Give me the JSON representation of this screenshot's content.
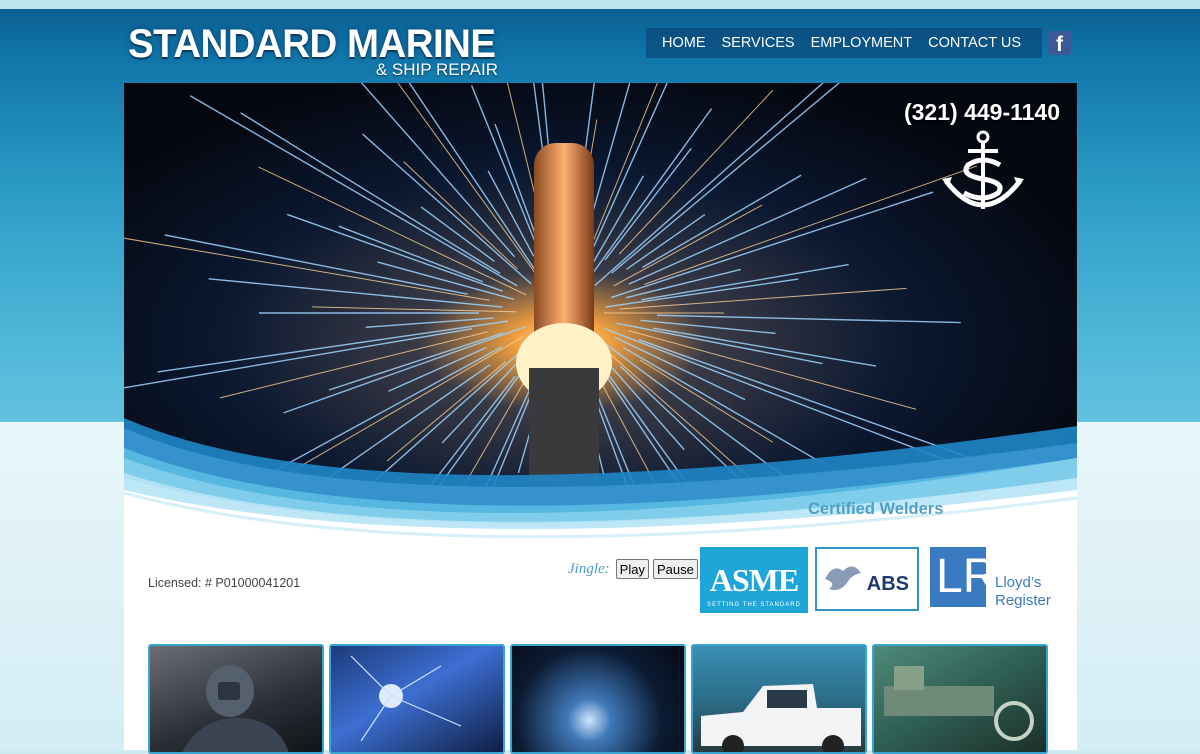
{
  "brand": {
    "name_line1": "STANDARD MARINE",
    "name_line2": "& SHIP REPAIR"
  },
  "nav": {
    "items": [
      {
        "label": "HOME"
      },
      {
        "label": "SERVICES"
      },
      {
        "label": "EMPLOYMENT"
      },
      {
        "label": "CONTACT US"
      }
    ],
    "social_icon": "facebook-icon"
  },
  "hero": {
    "phone": "(321) 449-1140",
    "logo_icon": "anchor-logo-icon",
    "image": "welding-sparks-photo"
  },
  "certifications": {
    "title": "Certified Welders",
    "badges": [
      {
        "name": "ASME",
        "tagline": "SETTING THE STANDARD"
      },
      {
        "name": "ABS"
      },
      {
        "name": "Lloyd's Register",
        "line1": "Lloyd’s",
        "line2": "Register",
        "mark": "LR"
      }
    ]
  },
  "license": {
    "text": "Licensed: # P01000041201"
  },
  "jingle": {
    "label": "Jingle:",
    "play_label": "Play",
    "pause_label": "Pause"
  },
  "thumbnails": [
    {
      "name": "welder-helmet-photo"
    },
    {
      "name": "welding-blue-sparks-photo"
    },
    {
      "name": "welding-arc-photo"
    },
    {
      "name": "service-truck-photo"
    },
    {
      "name": "lathe-machine-photo"
    }
  ],
  "colors": {
    "accent": "#4f9fc6",
    "nav_bg": "#0d4a80",
    "asme_blue": "#1fa6d8",
    "lloyd_blue": "#3a7ac0",
    "facebook_blue": "#3b5998"
  }
}
